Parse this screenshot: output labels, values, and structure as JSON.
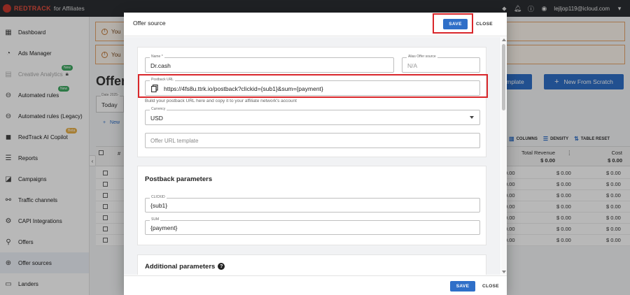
{
  "topbar": {
    "brand": "REDTRACK",
    "brand_suffix": "for Affiliates",
    "user_email": "lejljop119@icloud.com"
  },
  "sidebar": {
    "items": [
      {
        "label": "Dashboard",
        "icon": "dashboard-icon"
      },
      {
        "label": "Ads Manager",
        "icon": "ads-manager-icon"
      },
      {
        "label": "Creative Analytics",
        "icon": "creative-analytics-icon",
        "badge": "New",
        "disabled": true
      },
      {
        "label": "Automated rules",
        "icon": "automated-rules-icon",
        "badge": "New"
      },
      {
        "label": "Automated rules (Legacy)",
        "icon": "automated-rules-legacy-icon"
      },
      {
        "label": "RedTrack AI Copilot",
        "icon": "ai-copilot-icon",
        "badge": "Beta"
      },
      {
        "label": "Reports",
        "icon": "reports-icon"
      },
      {
        "label": "Campaigns",
        "icon": "campaigns-icon"
      },
      {
        "label": "Traffic channels",
        "icon": "traffic-channels-icon"
      },
      {
        "label": "CAPI Integrations",
        "icon": "capi-icon"
      },
      {
        "label": "Offers",
        "icon": "offers-icon"
      },
      {
        "label": "Offer sources",
        "icon": "offer-sources-icon",
        "active": true
      },
      {
        "label": "Landers",
        "icon": "landers-icon"
      }
    ]
  },
  "background": {
    "alert_text": "You",
    "page_title": "Offer",
    "template_button": "mplate",
    "new_scratch_button": "New From Scratch",
    "date_label": "Date 2025-",
    "date_value": "Today",
    "new_link": "New",
    "toolbar": {
      "columns": "COLUMNS",
      "density": "DENSITY",
      "table_reset": "TABLE RESET"
    },
    "table": {
      "hash": "#",
      "total_revenue": "Total Revenue",
      "total_revenue_sum": "$ 0.00",
      "cost": "Cost",
      "cost_sum": "$ 0.00",
      "rows": [
        {
          "partial": "0.00",
          "revenue": "$ 0.00",
          "cost": "$ 0.00"
        },
        {
          "partial": "0.00",
          "revenue": "$ 0.00",
          "cost": "$ 0.00"
        },
        {
          "partial": "0.00",
          "revenue": "$ 0.00",
          "cost": "$ 0.00"
        },
        {
          "partial": "0.00",
          "revenue": "$ 0.00",
          "cost": "$ 0.00"
        },
        {
          "partial": "0.00",
          "revenue": "$ 0.00",
          "cost": "$ 0.00"
        },
        {
          "partial": "0.00",
          "revenue": "$ 0.00",
          "cost": "$ 0.00"
        },
        {
          "partial": "0.00",
          "revenue": "$ 0.00",
          "cost": "$ 0.00"
        }
      ]
    }
  },
  "modal": {
    "title": "Offer source",
    "save_label": "SAVE",
    "close_label": "CLOSE",
    "name": {
      "label": "Name *",
      "value": "Dr.cash"
    },
    "alias": {
      "label": "Alias Offer source",
      "value": "N/A"
    },
    "postback": {
      "label": "Postback URL",
      "value": "https://4fs8u.ttrk.io/postback?clickid={sub1}&sum={payment}",
      "helper": "Build your postback URL here and copy it to your affiliate network's account"
    },
    "currency": {
      "label": "Currency",
      "value": "USD"
    },
    "offer_url_template": {
      "placeholder": "Offer URL template"
    },
    "postback_params": {
      "title": "Postback parameters",
      "clickid": {
        "label": "CLICKID",
        "value": "{sub1}"
      },
      "sum": {
        "label": "SUM",
        "value": "{payment}"
      }
    },
    "additional_params": {
      "title": "Additional parameters"
    }
  },
  "colors": {
    "accent": "#2f6fc8",
    "highlight": "#d9262a",
    "topbar": "#2b2e33"
  }
}
